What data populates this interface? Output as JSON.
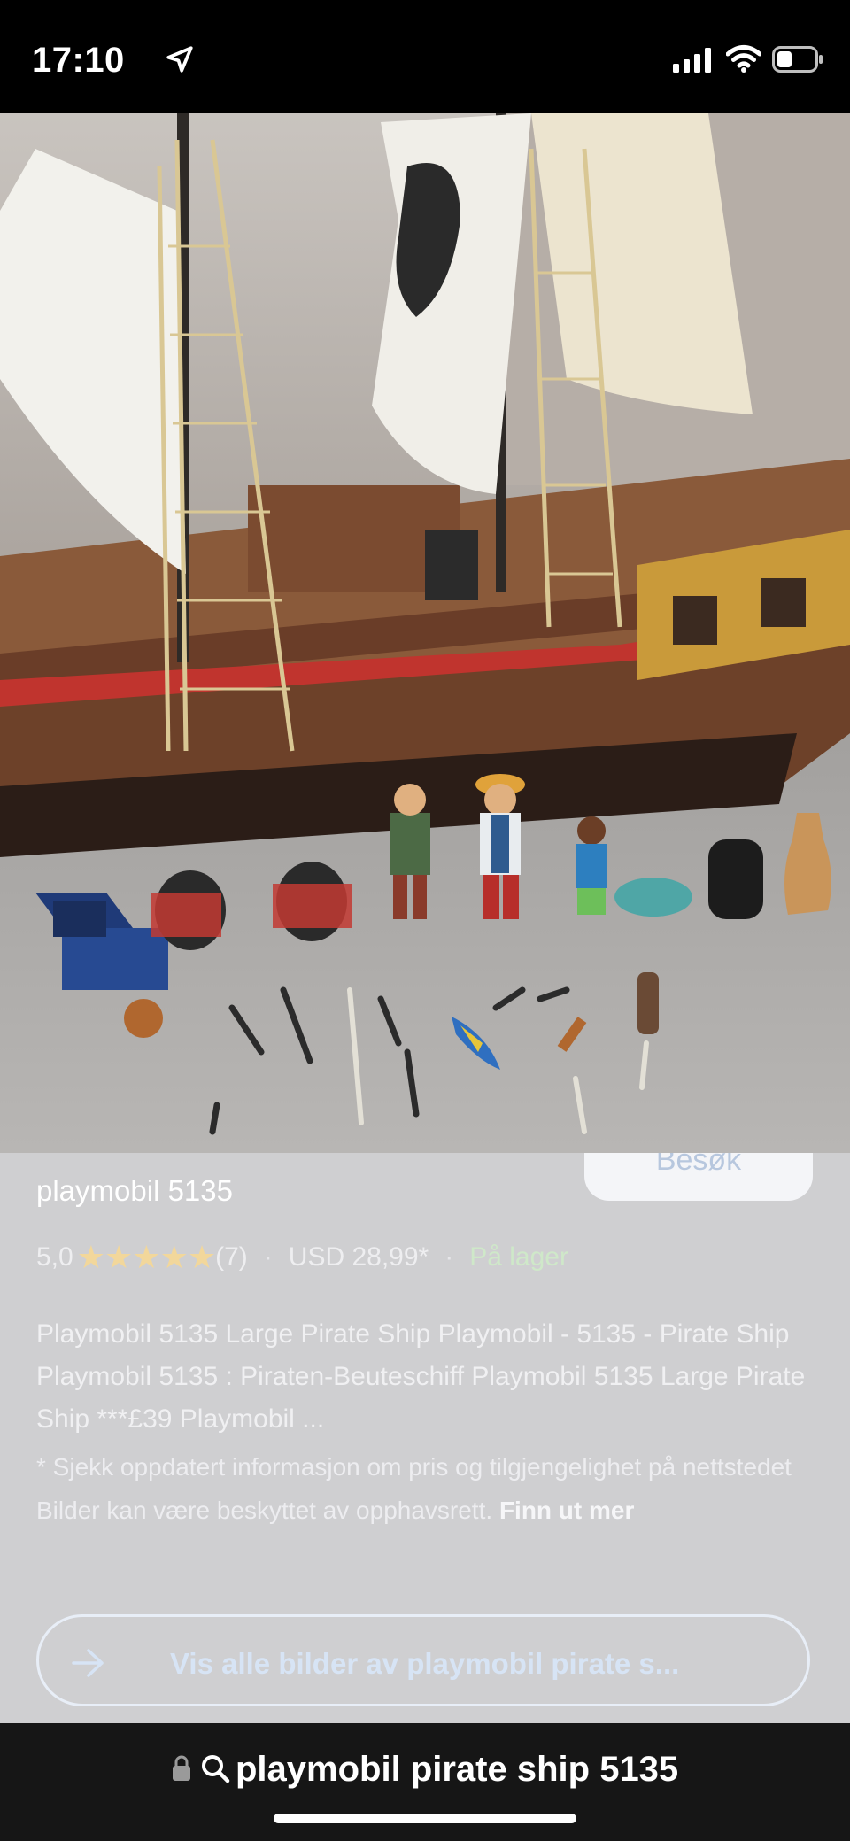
{
  "status_bar": {
    "time": "17:10",
    "icons": [
      "location-arrow-icon",
      "cellular-signal-icon",
      "wifi-icon",
      "battery-icon"
    ]
  },
  "photo": {
    "subject": "playmobil pirate ship with figures and accessories"
  },
  "result": {
    "visit_label": "Besøk",
    "title": "playmobil 5135",
    "rating": "5,0",
    "review_count": "(7)",
    "price": "USD 28,99*",
    "stock": "På lager",
    "separator": "·",
    "description": "Playmobil 5135 Large Pirate Ship Playmobil - 5135 - Pirate Ship Playmobil 5135 : Piraten-Beuteschiff Playmobil 5135 Large Pirate Ship ***£39 Playmobil ...",
    "disclaimer": "* Sjekk oppdatert informasjon om pris og tilgjengelighet på nettstedet Bilder kan være beskyttet av opphavsrett.",
    "learn_more": "Finn ut mer",
    "view_all": "Vis alle bilder av playmobil pirate s..."
  },
  "address_bar": {
    "query": "playmobil pirate ship 5135"
  },
  "colors": {
    "panel_bg": "#cfcfd1",
    "star": "#f2d79b",
    "stock": "#cfe8c9",
    "link": "#d7e4f5"
  }
}
